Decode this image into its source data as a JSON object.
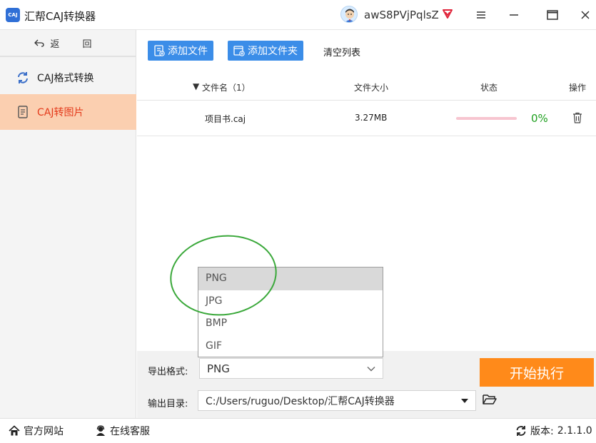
{
  "app": {
    "logo_text": "CAJ",
    "title": "汇帮CAJ转换器"
  },
  "user": {
    "name": "awS8PVjPqlsZ"
  },
  "sidebar": {
    "back_label": "返 回",
    "items": [
      {
        "label": "CAJ格式转换",
        "icon": "refresh-icon"
      },
      {
        "label": "CAJ转图片",
        "icon": "document-icon"
      }
    ]
  },
  "toolbar": {
    "add_file": "添加文件",
    "add_folder": "添加文件夹",
    "clear_list": "清空列表"
  },
  "table": {
    "headers": {
      "name": "文件名（1）",
      "size": "文件大小",
      "status": "状态",
      "action": "操作"
    },
    "rows": [
      {
        "name": "项目书.caj",
        "size": "3.27MB",
        "progress": "0%"
      }
    ]
  },
  "format": {
    "label": "导出格式:",
    "selected": "PNG",
    "options": [
      "PNG",
      "JPG",
      "BMP",
      "GIF"
    ]
  },
  "output": {
    "label": "输出目录:",
    "path": "C:/Users/ruguo/Desktop/汇帮CAJ转换器"
  },
  "start_button": "开始执行",
  "status_bar": {
    "website": "官方网站",
    "support": "在线客服",
    "version_label": "版本:",
    "version": "2.1.1.0"
  },
  "colors": {
    "accent": "#3b8de8",
    "start": "#ff8a1a",
    "active_tab_bg": "#fbcfb0",
    "active_tab_text": "#e43b1c",
    "success": "#20a020"
  }
}
